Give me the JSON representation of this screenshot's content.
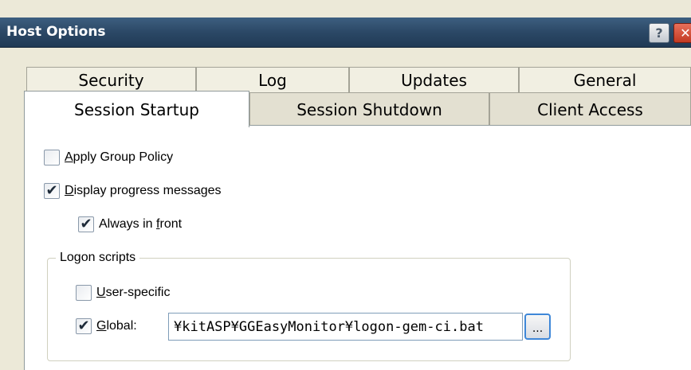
{
  "window": {
    "title": "Host Options",
    "help_label": "?",
    "close_label": "✕"
  },
  "tabs": {
    "back_row": [
      {
        "label": "Security"
      },
      {
        "label": "Log"
      },
      {
        "label": "Updates"
      },
      {
        "label": "General"
      }
    ],
    "front_row": [
      {
        "label": "Session Startup",
        "active": true
      },
      {
        "label": "Session Shutdown",
        "active": false
      },
      {
        "label": "Client Access",
        "active": false
      }
    ]
  },
  "options": {
    "apply_group_policy": {
      "accel": "A",
      "rest": "pply Group Policy",
      "checked": false
    },
    "display_progress": {
      "accel": "D",
      "rest": "isplay progress messages",
      "checked": true
    },
    "always_in_front": {
      "pre": "Always in ",
      "accel": "f",
      "rest": "ront",
      "checked": true
    }
  },
  "logon_scripts": {
    "title": "Logon scripts",
    "user_specific": {
      "accel": "U",
      "rest": "ser-specific",
      "checked": false
    },
    "global": {
      "accel": "G",
      "rest": "lobal:",
      "checked": true,
      "value": "¥kitASP¥GGEasyMonitor¥logon-gem-ci.bat"
    },
    "browse_label": "..."
  },
  "colors": {
    "titlebar": "#2b4866",
    "active_tab": "#ffffff",
    "inactive_tab": "#f1efe2"
  }
}
